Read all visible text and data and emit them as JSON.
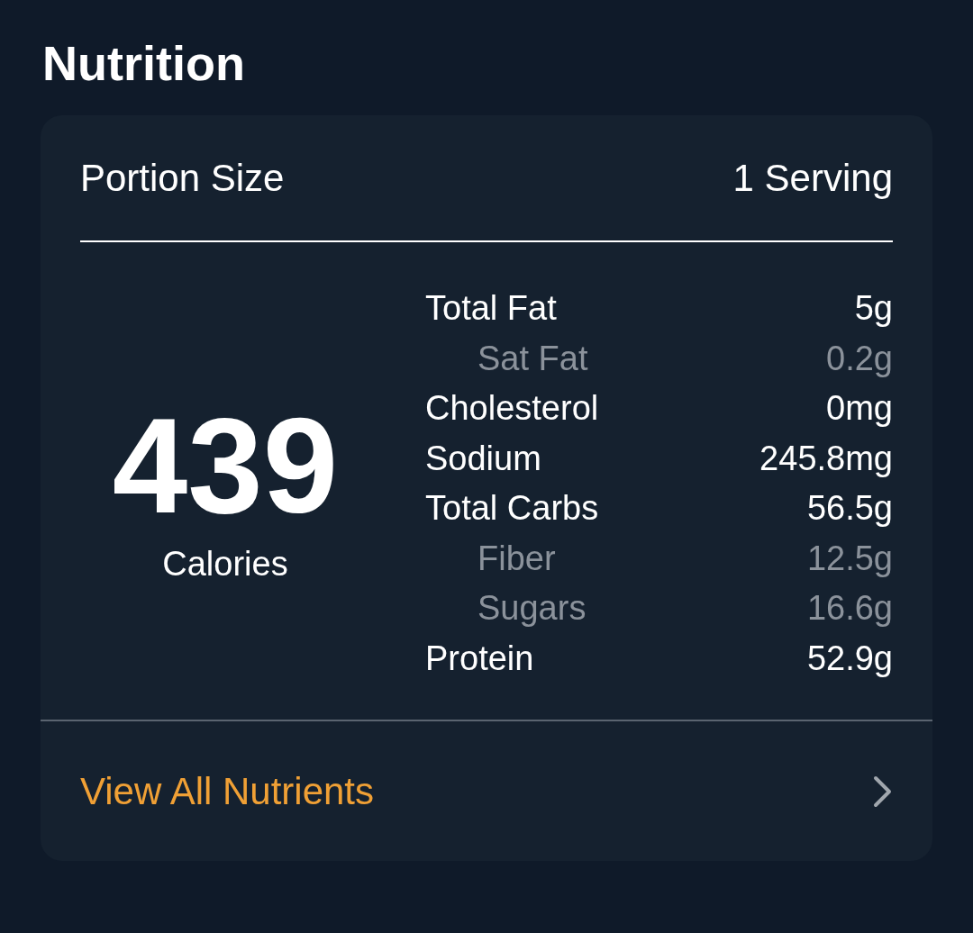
{
  "title": "Nutrition",
  "card": {
    "portion": {
      "label": "Portion Size",
      "value": "1 Serving"
    },
    "calories": {
      "value": "439",
      "label": "Calories"
    },
    "nutrients": [
      {
        "kind": "main",
        "name": "Total Fat",
        "value": "5g"
      },
      {
        "kind": "sub",
        "name": "Sat Fat",
        "value": "0.2g"
      },
      {
        "kind": "main",
        "name": "Cholesterol",
        "value": "0mg"
      },
      {
        "kind": "main",
        "name": "Sodium",
        "value": "245.8mg"
      },
      {
        "kind": "main",
        "name": "Total Carbs",
        "value": "56.5g"
      },
      {
        "kind": "sub",
        "name": "Fiber",
        "value": "12.5g"
      },
      {
        "kind": "sub",
        "name": "Sugars",
        "value": "16.6g"
      },
      {
        "kind": "main",
        "name": "Protein",
        "value": "52.9g"
      }
    ],
    "link": "View All Nutrients"
  }
}
